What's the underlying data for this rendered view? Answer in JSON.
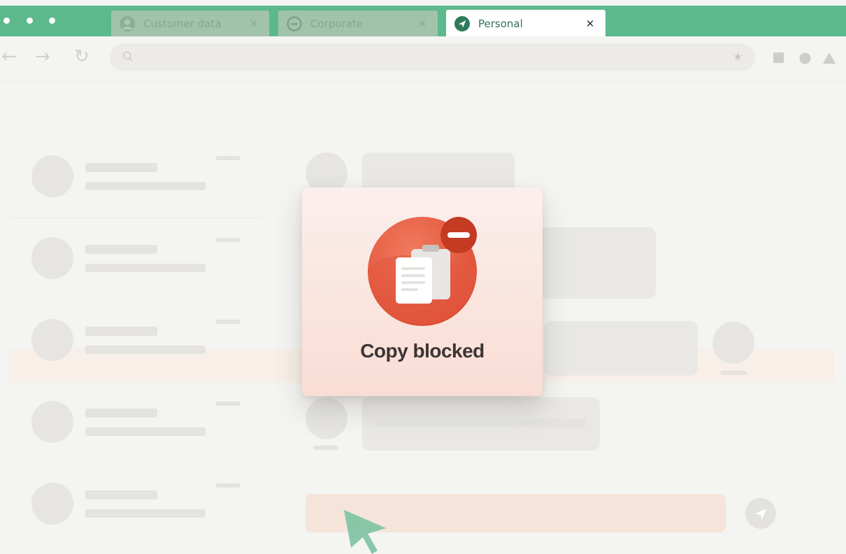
{
  "browser": {
    "tabs": [
      {
        "title": "Customer data",
        "icon": "person-icon",
        "state": "inactive"
      },
      {
        "title": "Corporate",
        "icon": "smiley-icon",
        "state": "inactive"
      },
      {
        "title": "Personal",
        "icon": "send-icon",
        "state": "active"
      }
    ],
    "close_glyph": "✕",
    "nav": {
      "back": "←",
      "forward": "→",
      "reload": "↻"
    },
    "address_bar": {
      "value": ""
    },
    "extensions": [
      "square-icon",
      "circle-icon",
      "triangle-icon"
    ]
  },
  "chat": {
    "composer_value": "",
    "send_icon": "send-icon"
  },
  "modal": {
    "title": "Copy blocked",
    "icon": "clipboard-blocked-icon"
  },
  "colors": {
    "tab_bar": "#5cb98c",
    "accent_red": "#e4553b",
    "blocked_badge": "#c43a22",
    "cursor": "#7cc2a2",
    "active_tab_icon": "#2e7b5b"
  }
}
